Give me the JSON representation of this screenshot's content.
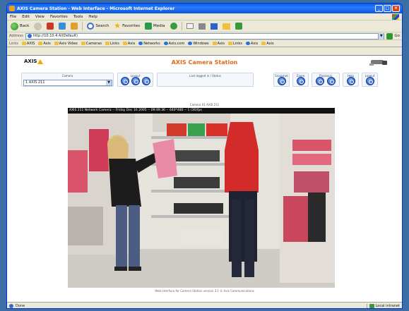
{
  "window": {
    "title": "AXIS Camera Station - Web Interface - Microsoft Internet Explorer",
    "buttons": {
      "minimize": "_",
      "maximize": "□",
      "close": "×"
    }
  },
  "menubar": [
    "File",
    "Edit",
    "View",
    "Favorites",
    "Tools",
    "Help"
  ],
  "toolbar": {
    "back_label": "Back",
    "search_label": "Search",
    "favorites_label": "Favorites",
    "media_label": "Media"
  },
  "addressbar": {
    "label": "Address",
    "url": "http://10.10.4.4/(Default)",
    "go_label": "Go"
  },
  "linksbar": {
    "label": "Links",
    "items": [
      "AXIS",
      "Axis",
      "Axis Video",
      "Cameras",
      "Links",
      "Axis",
      "Networks",
      "Axis.com",
      "Windows",
      "Axis",
      "Links",
      "Axis",
      "Axis"
    ]
  },
  "page": {
    "logo_text": "AXIS",
    "title": "AXIS Camera Station"
  },
  "controls": {
    "camera_label": "Camera",
    "camera_value": "1 AXIS 211",
    "select_arrow": "▼",
    "layout_label": "Layout",
    "status_label": "Last logged in / Status",
    "snapshot_label": "Snapshot",
    "zoom_label": "Zoom",
    "playback_label": "Playback",
    "help_label": "Help",
    "logout_label": "Logout"
  },
  "video": {
    "caption": "Camera 01 AXIS 211",
    "overlay": "AXIS 211 Network Camera -- Friday Dec 16 2005 -- 09:49:36 -- 640*480 -- 1 (30)fps",
    "footer": "Web Interface for Camera Station version 3.1 © Axis Communications"
  },
  "statusbar": {
    "left_text": "Done",
    "zone_text": "Local intranet"
  }
}
